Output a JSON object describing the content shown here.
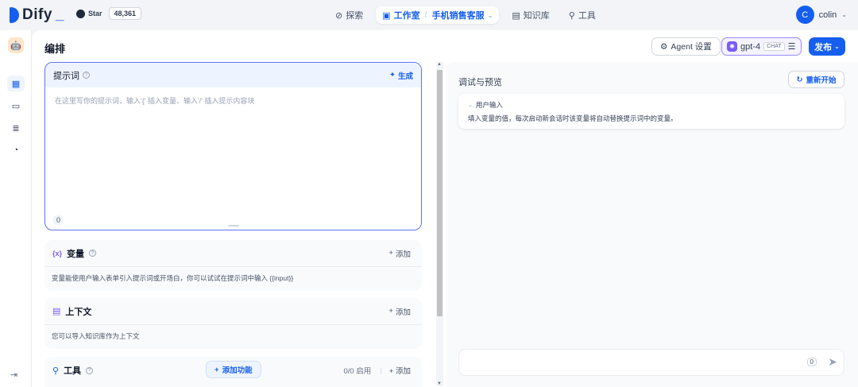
{
  "app": {
    "name": "Dify"
  },
  "github": {
    "star_label": "Star",
    "star_count": "48,361"
  },
  "nav": {
    "explore": "探索",
    "studio": "工作室",
    "app_name": "手机销售客服",
    "knowledge": "知识库",
    "tools": "工具"
  },
  "user": {
    "initial": "C",
    "name": "colin"
  },
  "header": {
    "title": "编排",
    "agent_settings": "Agent 设置",
    "model": "gpt-4",
    "model_badge": "CHAT",
    "publish": "发布"
  },
  "prompt": {
    "title": "提示词",
    "generate": "生成",
    "placeholder": "在这里写你的提示词，输入'{' 插入变量、输入'/' 插入提示内容块",
    "count": "0"
  },
  "variables": {
    "title": "变量",
    "add": "添加",
    "desc": "变量能使用户输入表单引入提示词或开场白，你可以试试在提示词中输入 {{input}}"
  },
  "context": {
    "title": "上下文",
    "add": "添加",
    "desc": "您可以导入知识库作为上下文"
  },
  "tools": {
    "title": "工具",
    "enabled": "0/0 启用",
    "add": "添加"
  },
  "add_feature": "添加功能",
  "preview": {
    "title": "调试与预览",
    "restart": "重新开始",
    "user_input_title": "用户输入",
    "user_input_desc": "填入变量的值，每次启动新会话时该变量将自动替换提示词中的变量。",
    "chat_count": "0"
  },
  "colors": {
    "primary": "#155eef",
    "accent": "#7a5af8"
  }
}
